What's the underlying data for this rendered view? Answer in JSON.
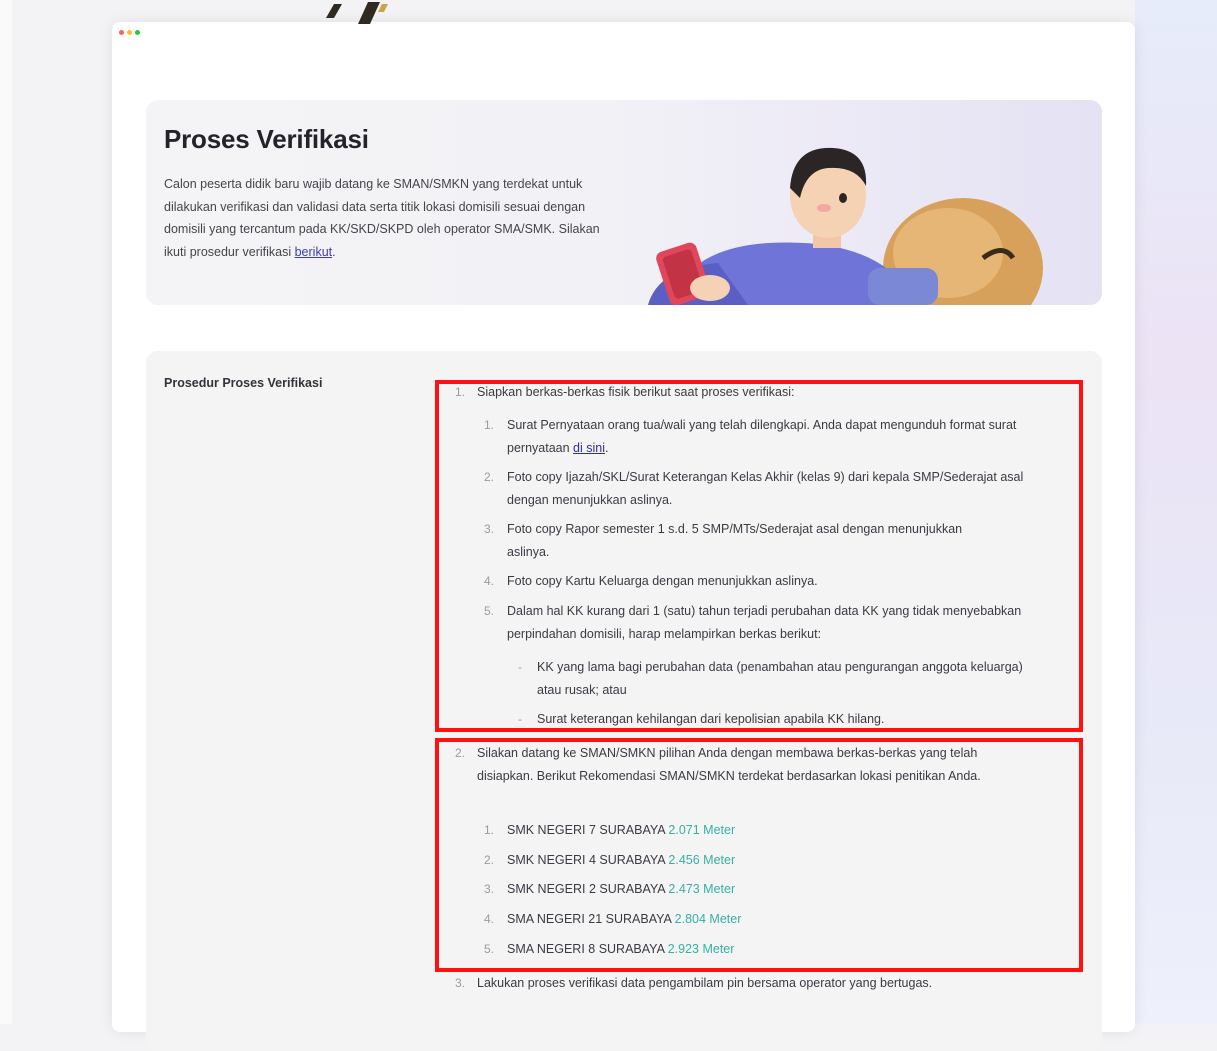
{
  "hero": {
    "title": "Proses Verifikasi",
    "description": "Calon peserta didik baru wajib datang ke SMAN/SMKN yang terdekat untuk dilakukan verifikasi dan validasi data serta titik lokasi domisili sesuai dengan domisili yang tercantum pada KK/SKD/SKPD oleh operator SMA/SMK. Silakan ikuti prosedur verifikasi ",
    "link_text": "berikut",
    "desc_end": "."
  },
  "procedure": {
    "label": "Prosedur Proses Verifikasi",
    "step1": {
      "number": "1.",
      "text": "Siapkan berkas-berkas fisik berikut saat proses verifikasi:",
      "items": [
        {
          "number": "1.",
          "text": "Surat Pernyataan orang tua/wali yang telah dilengkapi. Anda dapat mengunduh format surat pernyataan ",
          "link": "di sini",
          "end": "."
        },
        {
          "number": "2.",
          "text": "Foto copy Ijazah/SKL/Surat Keterangan Kelas Akhir (kelas 9) dari kepala SMP/Sederajat asal dengan menunjukkan aslinya."
        },
        {
          "number": "3.",
          "text": "Foto copy Rapor semester 1 s.d. 5 SMP/MTs/Sederajat asal dengan menunjukkan aslinya."
        },
        {
          "number": "4.",
          "text": "Foto copy Kartu Keluarga dengan menunjukkan aslinya."
        },
        {
          "number": "5.",
          "text": "Dalam hal KK kurang dari 1 (satu) tahun terjadi perubahan data KK yang tidak menyebabkan perpindahan domisili, harap melampirkan berkas berikut:",
          "subitems": [
            {
              "bullet": "-",
              "text": "KK yang lama bagi perubahan data (penambahan atau pengurangan anggota keluarga) atau rusak; atau"
            },
            {
              "bullet": "-",
              "text": "Surat keterangan kehilangan dari kepolisian apabila KK hilang."
            }
          ]
        }
      ]
    },
    "step2": {
      "number": "2.",
      "text": "Silakan datang ke SMAN/SMKN pilihan Anda dengan membawa berkas-berkas yang telah disiapkan. Berikut Rekomendasi SMAN/SMKN terdekat berdasarkan lokasi penitikan Anda.",
      "schools": [
        {
          "number": "1.",
          "name": "SMK NEGERI 7 SURABAYA",
          "distance": "2.071 Meter"
        },
        {
          "number": "2.",
          "name": "SMK NEGERI 4 SURABAYA",
          "distance": "2.456 Meter"
        },
        {
          "number": "3.",
          "name": "SMK NEGERI 2 SURABAYA",
          "distance": "2.473 Meter"
        },
        {
          "number": "4.",
          "name": "SMA NEGERI 21 SURABAYA",
          "distance": "2.804 Meter"
        },
        {
          "number": "5.",
          "name": "SMA NEGERI 8 SURABAYA",
          "distance": "2.923 Meter"
        }
      ]
    },
    "step3": {
      "number": "3.",
      "text": "Lakukan proses verifikasi data pengambilam pin bersama operator yang bertugas."
    }
  },
  "colors": {
    "highlight": "#ff1111",
    "distance": "#37b0a4",
    "link": "#2d2daa"
  }
}
